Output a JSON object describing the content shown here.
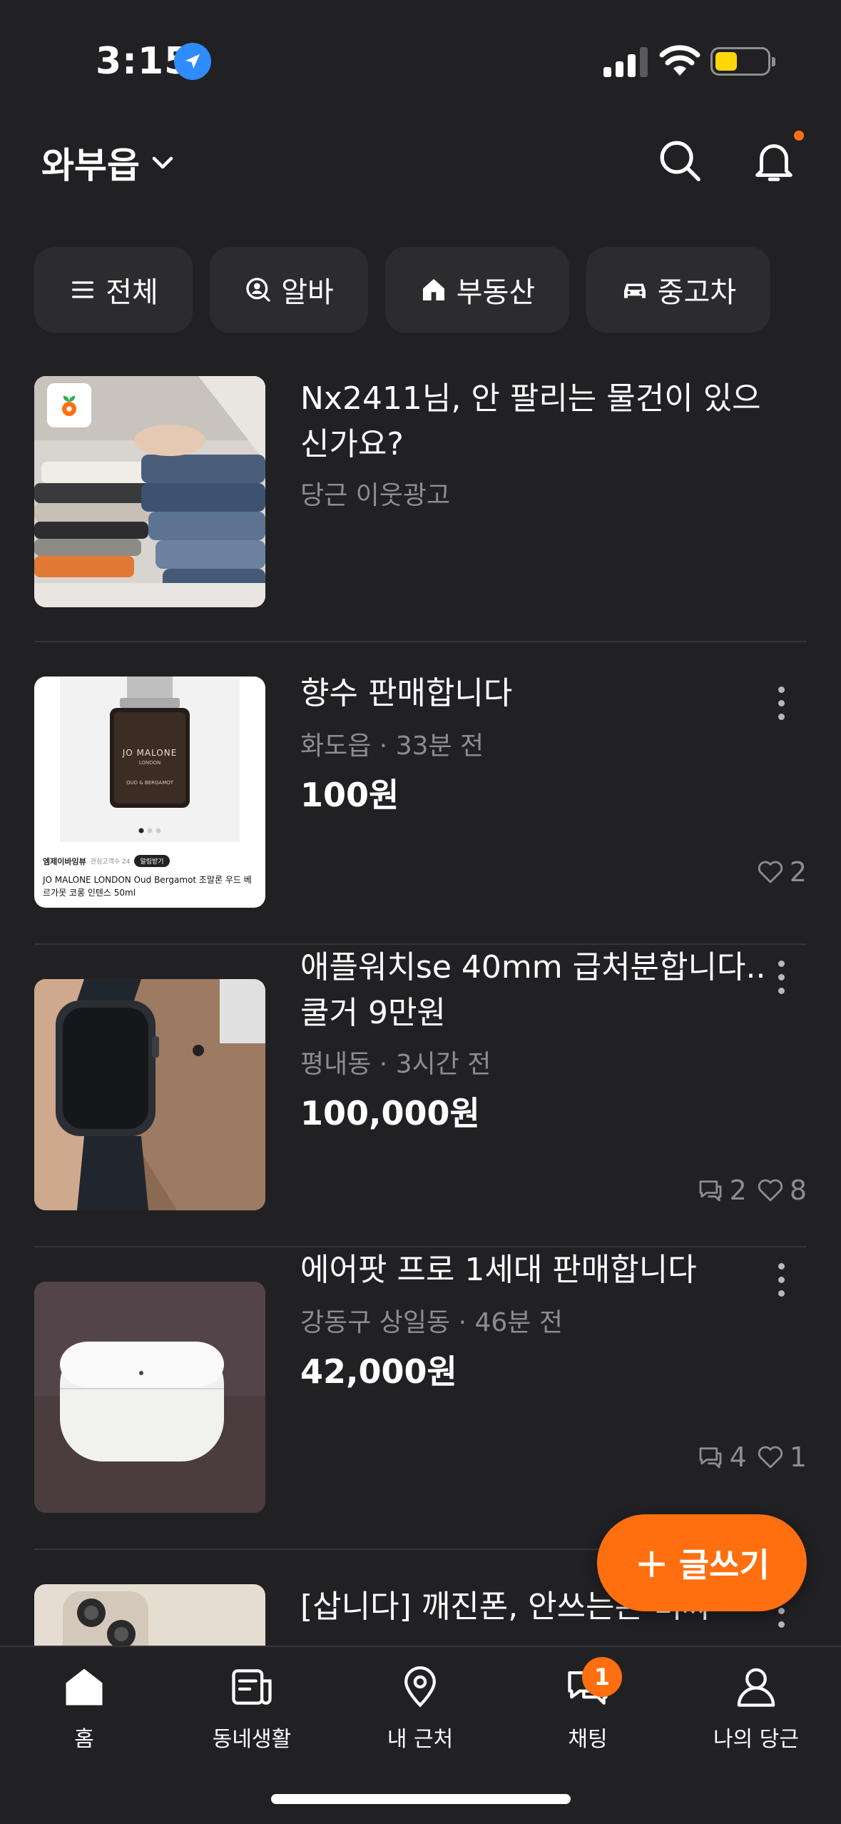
{
  "status_bar": {
    "time": "3:15"
  },
  "header": {
    "location": "와부읍"
  },
  "categories": [
    {
      "label": "전체",
      "icon": "menu-icon"
    },
    {
      "label": "알바",
      "icon": "job-search-icon"
    },
    {
      "label": "부동산",
      "icon": "house-icon"
    },
    {
      "label": "중고차",
      "icon": "car-icon"
    }
  ],
  "items": [
    {
      "title": "Nx2411님, 안 팔리는 물건이 있으신가요?",
      "meta": "당근 이웃광고"
    },
    {
      "title": "향수 판매합니다",
      "meta": "화도읍 · 33분 전",
      "price": "100원",
      "likes": "2",
      "thumb": {
        "brand": "JO MALONE",
        "sub": "LONDON",
        "label": "OUD & BERGAMOT",
        "shop": "엠제이바잉뷰",
        "interest": "관심고객수 24",
        "notify": "알림받기",
        "desc": "JO MALONE LONDON Oud Bergamot 조말론 우드 베르가못 코롱 인텐스 50ml"
      }
    },
    {
      "title": "애플워치se 40mm 급처분합니다.. 쿨거 9만원",
      "meta": "평내동 · 3시간 전",
      "price": "100,000원",
      "chats": "2",
      "likes": "8"
    },
    {
      "title": "에어팟 프로 1세대 판매합니다",
      "meta": "강동구 상일동 · 46분 전",
      "price": "42,000원",
      "chats": "4",
      "likes": "1"
    },
    {
      "title": "[삽니다] 깨진폰, 안쓰는폰 비싸"
    }
  ],
  "fab": {
    "label": "글쓰기"
  },
  "nav": [
    {
      "label": "홈",
      "icon": "home-icon"
    },
    {
      "label": "동네생활",
      "icon": "community-icon"
    },
    {
      "label": "내 근처",
      "icon": "location-pin-icon"
    },
    {
      "label": "채팅",
      "icon": "chat-icon",
      "badge": "1"
    },
    {
      "label": "나의 당근",
      "icon": "profile-icon"
    }
  ],
  "colors": {
    "background": "#212124",
    "accent": "#ff6f0f",
    "chip": "#2c2c2f",
    "muted": "#8c8c92"
  }
}
